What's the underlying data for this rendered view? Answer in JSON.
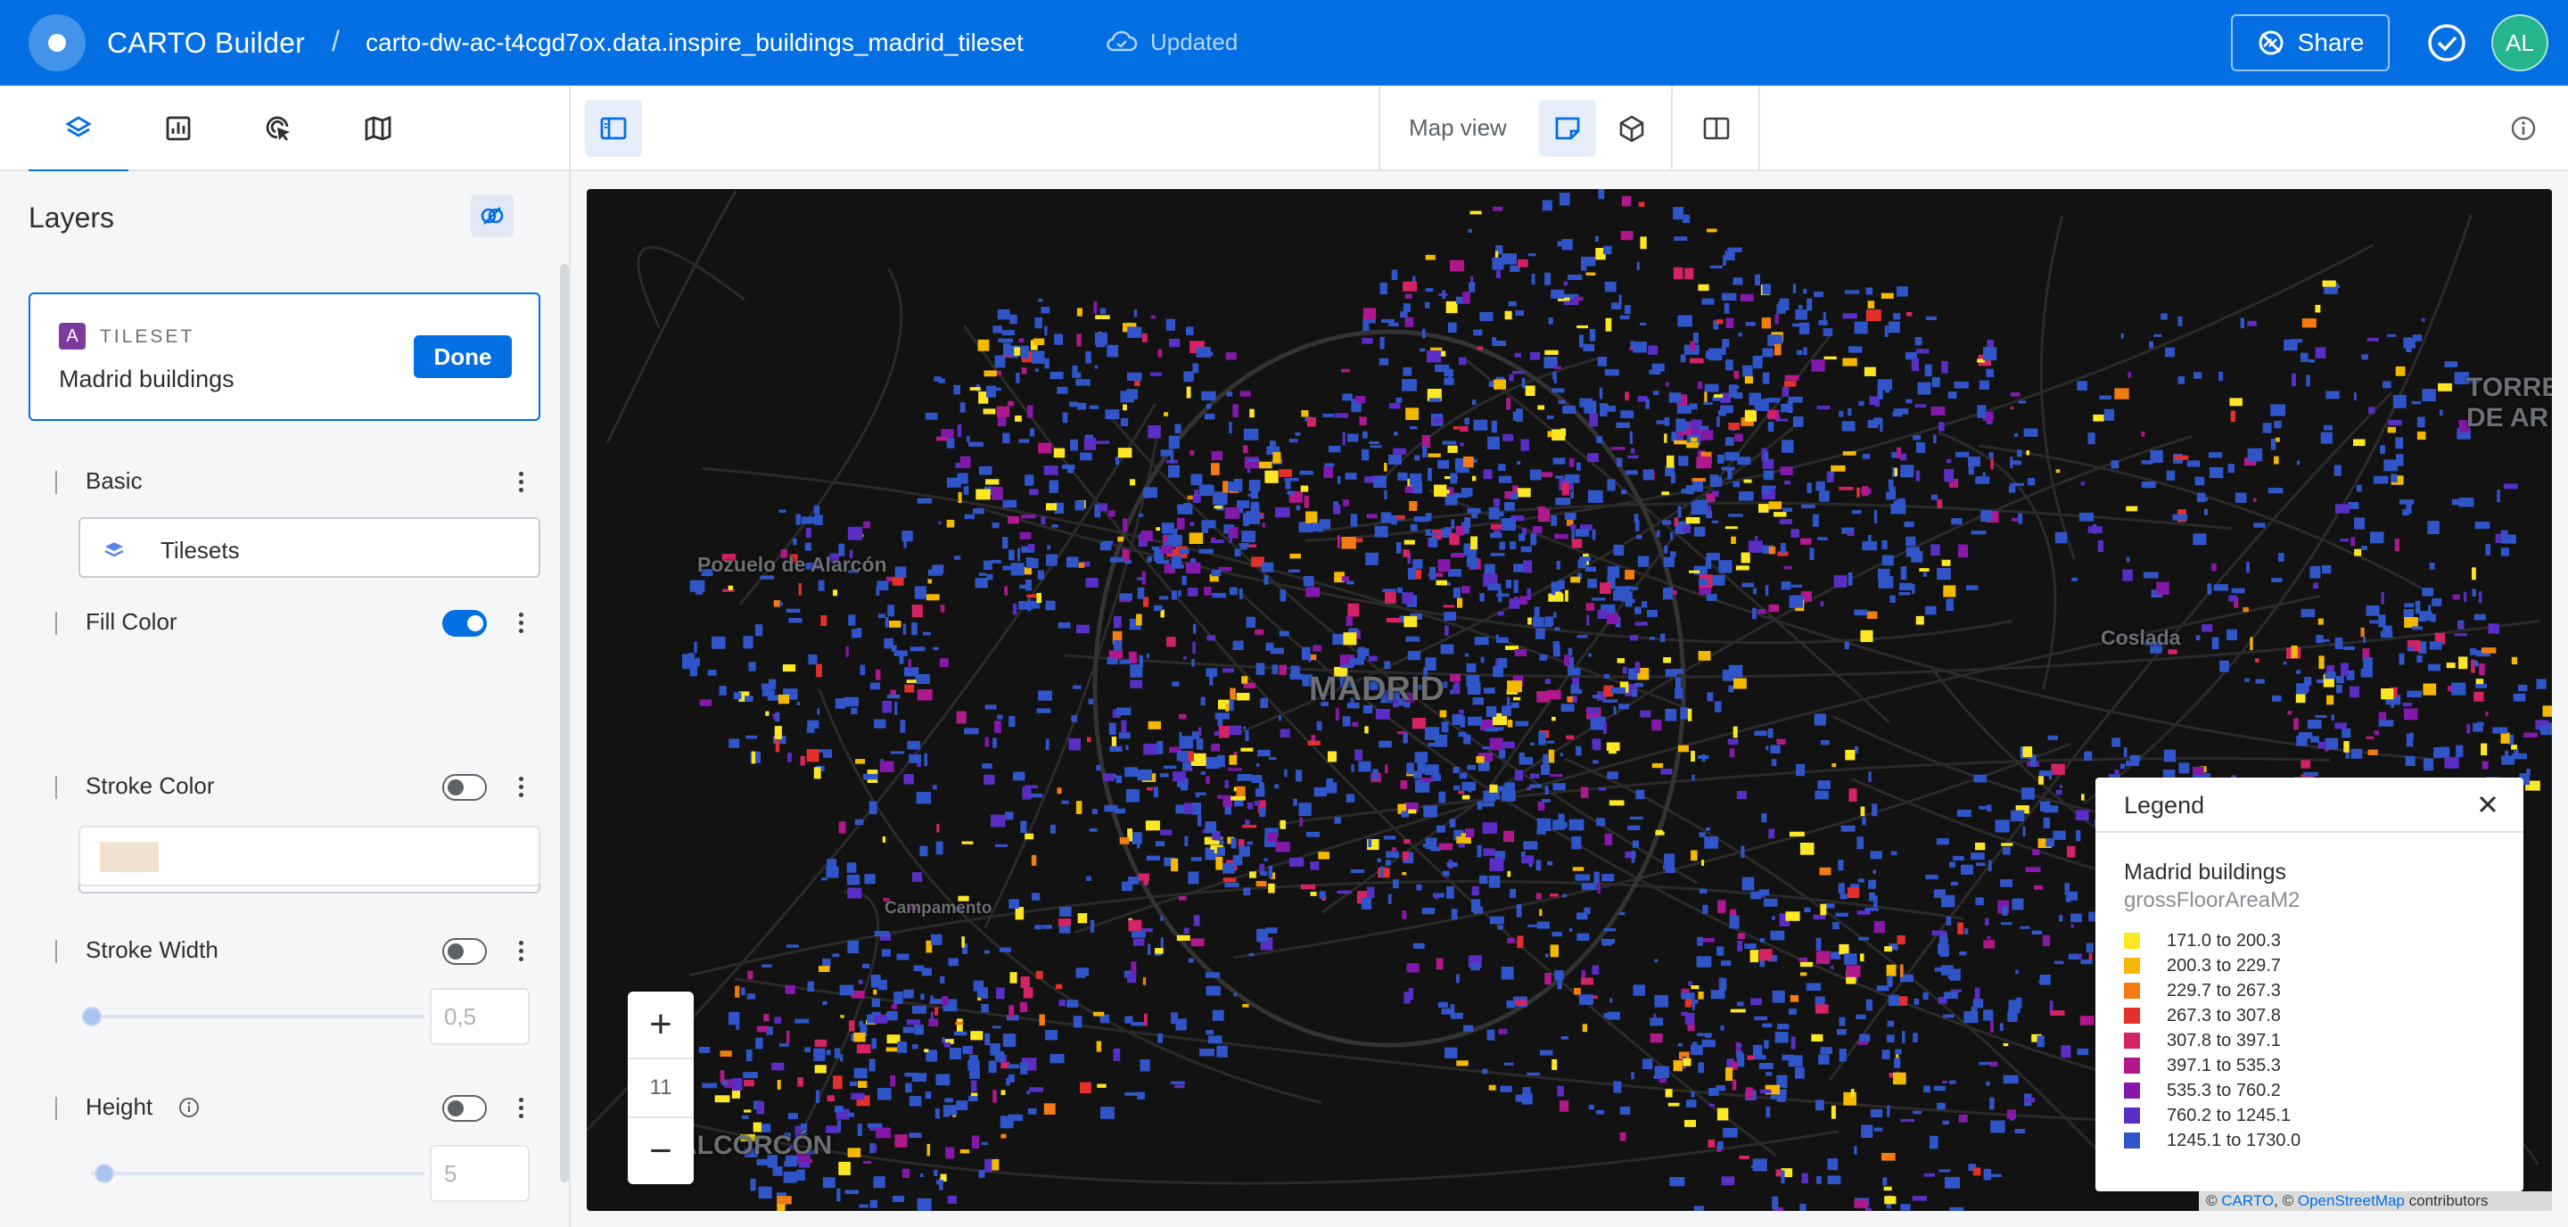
{
  "header": {
    "app_title": "CARTO Builder",
    "separator": "/",
    "map_name": "carto-dw-ac-t4cgd7ox.data.inspire_buildings_madrid_tileset",
    "save_status": "Updated",
    "share_label": "Share",
    "user_initials": "AL"
  },
  "toolbar": {
    "view_mode_label": "Map view"
  },
  "sidebar": {
    "title": "Layers",
    "layer": {
      "badge": "A",
      "type": "TILESET",
      "name": "Madrid buildings",
      "done_label": "Done"
    },
    "sections": {
      "basic": {
        "label": "Basic",
        "source": "Tilesets"
      },
      "fill_color": {
        "label": "Fill Color",
        "enabled": true
      },
      "stroke_color": {
        "label": "Stroke Color",
        "enabled": false,
        "swatch": "#f1e2d2"
      },
      "stroke_width": {
        "label": "Stroke Width",
        "enabled": false,
        "value": "0,5"
      },
      "height": {
        "label": "Height",
        "enabled": false,
        "value": "5"
      }
    },
    "color_ramp": [
      "#fde725",
      "#f5b800",
      "#f27c12",
      "#e3302c",
      "#d42266",
      "#b0188c",
      "#8318aa",
      "#5a2dc4",
      "#2f55c8"
    ]
  },
  "map": {
    "places": {
      "madrid": "MADRID",
      "pozuelo": "Pozuelo de Alarcón",
      "coslada": "Coslada",
      "campamento": "Campamento",
      "alcorcon": "ALCORCÓN",
      "torrejon": "TORRE DE AR"
    },
    "zoom_level": "11",
    "zoom_in": "+",
    "zoom_out": "−",
    "attribution": {
      "prefix": "©",
      "carto": "CARTO",
      "mid": ", ©",
      "osm": "OpenStreetMap",
      "suffix": "contributors"
    }
  },
  "legend": {
    "title": "Legend",
    "layer_name": "Madrid buildings",
    "attribute": "grossFloorAreaM2",
    "items": [
      {
        "label": "171.0 to 200.3",
        "color": "#fde725"
      },
      {
        "label": "200.3 to 229.7",
        "color": "#f5b800"
      },
      {
        "label": "229.7 to 267.3",
        "color": "#f27c12"
      },
      {
        "label": "267.3 to 307.8",
        "color": "#e3302c"
      },
      {
        "label": "307.8 to 397.1",
        "color": "#d42266"
      },
      {
        "label": "397.1 to 535.3",
        "color": "#b0188c"
      },
      {
        "label": "535.3 to 760.2",
        "color": "#8318aa"
      },
      {
        "label": "760.2 to 1245.1",
        "color": "#5a2dc4"
      },
      {
        "label": "1245.1 to 1730.0",
        "color": "#2f55c8"
      }
    ]
  }
}
